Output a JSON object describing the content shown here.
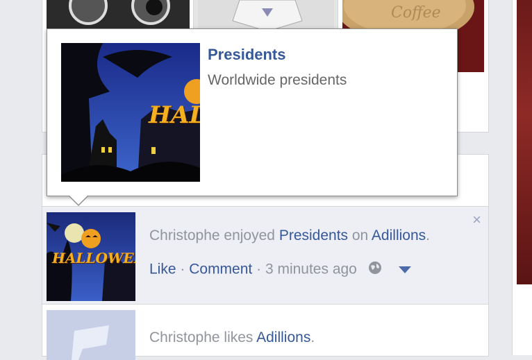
{
  "popup": {
    "title": "Presidents",
    "subtitle": "Worldwide presidents",
    "image_label": "HALLOWEEN"
  },
  "story1": {
    "actor": "Christophe",
    "verb": "enjoyed",
    "object_link": "Presidents",
    "preposition": "on",
    "app_link": "Adillions",
    "period": ".",
    "like_label": "Like",
    "sep1": "·",
    "comment_label": "Comment",
    "sep2": "·",
    "time": "3 minutes ago",
    "close_glyph": "×",
    "privacy_icon": "globe-icon",
    "menu_icon": "chevron-down-icon",
    "thumb_label": "HALLOWEEN"
  },
  "story2": {
    "actor": "Christophe",
    "verb": "likes",
    "app_link": "Adillions",
    "period": "."
  },
  "thumbs": {
    "coffee_text": "Coffee"
  },
  "colors": {
    "link": "#365899",
    "muted": "#90949c",
    "feed_bg": "#e9eaee"
  }
}
